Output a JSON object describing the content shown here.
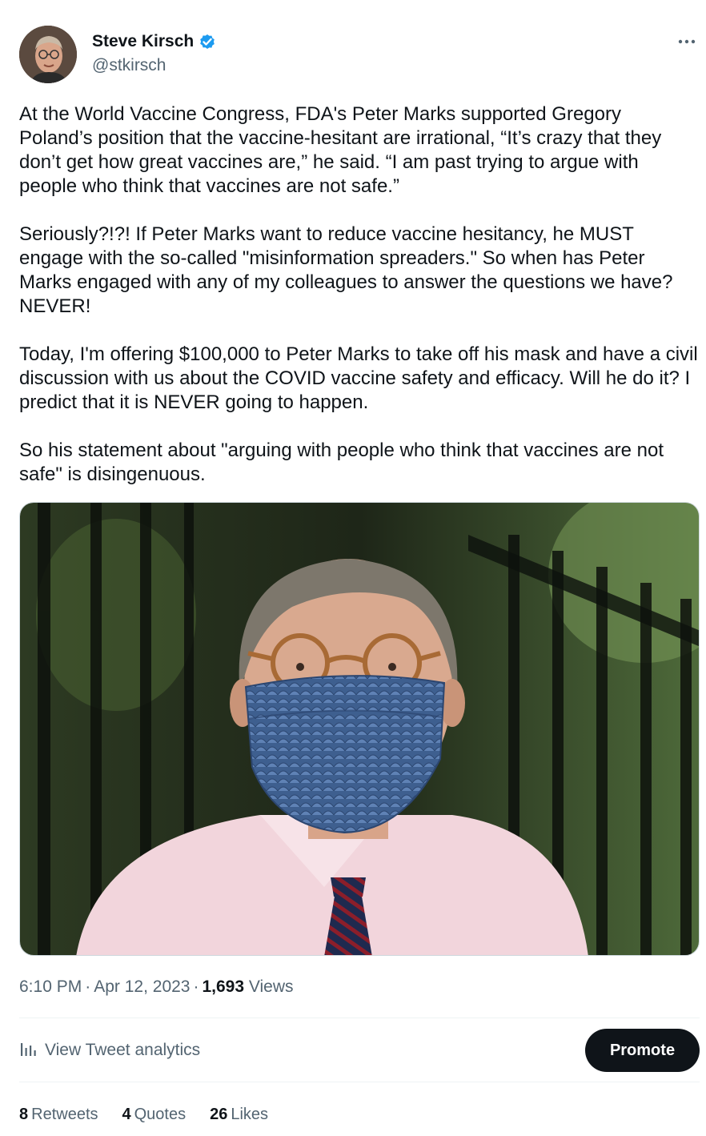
{
  "author": {
    "display_name": "Steve Kirsch",
    "handle": "@stkirsch",
    "verified_icon": "verified-badge-icon",
    "verified_color": "#1d9bf0"
  },
  "tweet": {
    "paragraphs": [
      "At the World Vaccine Congress, FDA's Peter Marks supported Gregory Poland’s position that the vaccine-hesitant are irrational, “It’s crazy that they don’t get how great vaccines are,” he said. “I am past trying to argue with people who think that vaccines are not safe.”",
      "Seriously?!?! If Peter Marks want to reduce vaccine hesitancy, he MUST engage with the so-called \"misinformation spreaders.\" So when has Peter Marks engaged with any of my colleagues to answer the questions we have? NEVER!",
      "Today, I'm offering $100,000 to Peter Marks to take off his mask and have a civil discussion with us about the COVID vaccine safety and efficacy. Will he do it? I predict that it is NEVER going to happen.",
      "So his statement about \"arguing with people who think that vaccines are not safe\" is disingenuous."
    ]
  },
  "meta": {
    "time": "6:10 PM",
    "separator": "·",
    "date": "Apr 12, 2023",
    "views_count": "1,693",
    "views_label": "Views"
  },
  "actions": {
    "analytics_label": "View Tweet analytics",
    "analytics_icon": "bar-chart-icon",
    "promote_label": "Promote"
  },
  "stats": [
    {
      "count": "8",
      "label": "Retweets"
    },
    {
      "count": "4",
      "label": "Quotes"
    },
    {
      "count": "26",
      "label": "Likes"
    }
  ],
  "colors": {
    "text": "#0f1419",
    "secondary": "#536471",
    "divider": "#eff3f4",
    "promote_bg": "#0f1419"
  }
}
